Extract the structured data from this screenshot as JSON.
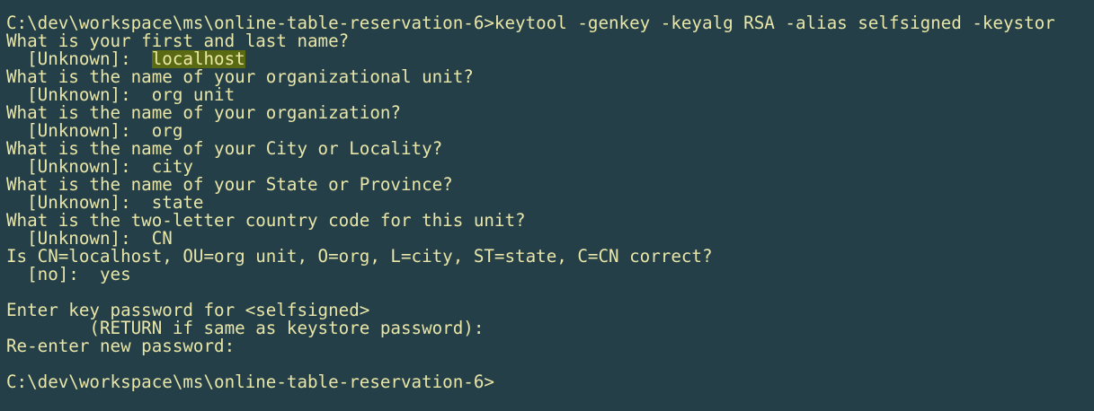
{
  "terminal": {
    "lines": [
      "C:\\dev\\workspace\\ms\\online-table-reservation-6>keytool -genkey -keyalg RSA -alias selfsigned -keystor",
      "What is your first and last name?",
      "  [Unknown]:  ",
      "What is the name of your organizational unit?",
      "  [Unknown]:  org unit",
      "What is the name of your organization?",
      "  [Unknown]:  org",
      "What is the name of your City or Locality?",
      "  [Unknown]:  city",
      "What is the name of your State or Province?",
      "  [Unknown]:  state",
      "What is the two-letter country code for this unit?",
      "  [Unknown]:  CN",
      "Is CN=localhost, OU=org unit, O=org, L=city, ST=state, C=CN correct?",
      "  [no]:  yes",
      "",
      "Enter key password for <selfsigned>",
      "        (RETURN if same as keystore password):",
      "Re-enter new password:",
      "",
      "C:\\dev\\workspace\\ms\\online-table-reservation-6>"
    ],
    "highlighted_answer": "localhost"
  }
}
